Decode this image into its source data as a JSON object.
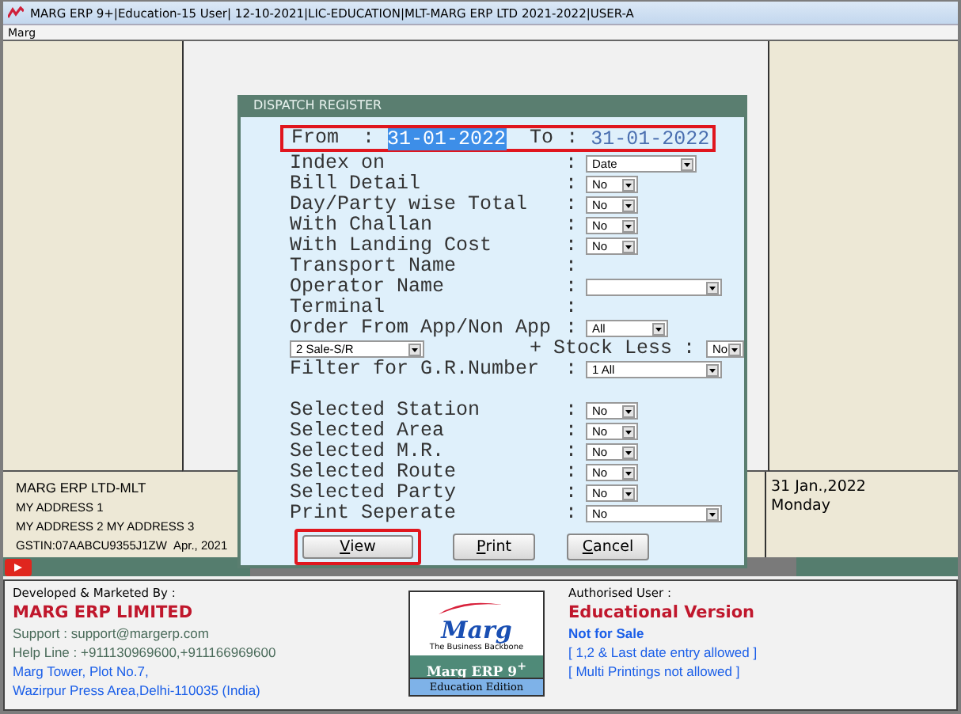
{
  "window": {
    "title": "MARG ERP 9+|Education-15 User| 12-10-2021|LIC-EDUCATION|MLT-MARG ERP LTD 2021-2022|USER-A"
  },
  "menu": [
    "Marg"
  ],
  "company": {
    "name": "MARG ERP LTD-MLT",
    "lines": [
      "MY ADDRESS 1",
      "MY ADDRESS 2 MY ADDRESS 3"
    ],
    "gstin": "GSTIN:07AABCU9355J1ZW",
    "period": "Apr., 2021"
  },
  "today": {
    "date": "31 Jan.,2022",
    "day": "Monday"
  },
  "dialog": {
    "title": "DISPATCH REGISTER",
    "date_range": {
      "from_label": "From",
      "from_colon": ":",
      "from": "31-01-2022",
      "from_selected": true,
      "to_label": "To",
      "to_colon": ":",
      "to": "31-01-2022",
      "to_selected": false
    },
    "fields": [
      {
        "kind": "sort",
        "label": "Index on",
        "colon": ":",
        "value": "Date"
      },
      {
        "kind": "toggle",
        "label": "Bill Detail",
        "colon": ":",
        "value": "No"
      },
      {
        "kind": "toggle",
        "label": "Day/Party wise Total",
        "colon": ":",
        "value": "No"
      },
      {
        "kind": "toggle",
        "label": "With Challan",
        "colon": ":",
        "value": "No"
      },
      {
        "kind": "toggle",
        "label": "With Landing Cost",
        "colon": ":",
        "value": "No"
      },
      {
        "kind": "text",
        "label": "Transport Name",
        "colon": ":"
      },
      {
        "kind": "combo",
        "label": "Operator Name",
        "colon": ":"
      },
      {
        "kind": "text",
        "label": "Terminal",
        "colon": ":"
      },
      {
        "kind": "choice",
        "label": "Order From App/Non App",
        "colon": ":",
        "value": "All"
      },
      {
        "kind": "split",
        "left_value": "2 Sale-S/R",
        "label": "+ Stock Less",
        "colon": ":",
        "value": "No"
      },
      {
        "kind": "combo",
        "label": "Filter for G.R.Number",
        "colon": ":",
        "value": "1 All"
      }
    ],
    "selection_fields": [
      {
        "kind": "toggle",
        "label": "Selected Station",
        "colon": ":",
        "value": "No"
      },
      {
        "kind": "toggle",
        "label": "Selected Area",
        "colon": ":",
        "value": "No"
      },
      {
        "kind": "toggle",
        "label": "Selected M.R.",
        "colon": ":",
        "value": "No"
      },
      {
        "kind": "toggle",
        "label": "Selected Route",
        "colon": ":",
        "value": "No"
      },
      {
        "kind": "toggle",
        "label": "Selected Party",
        "colon": ":",
        "value": "No"
      },
      {
        "kind": "combo",
        "label": "Print Seperate",
        "colon": ":",
        "value": "No"
      }
    ],
    "buttons": [
      {
        "label": "View",
        "selected": true
      },
      {
        "label": "Print",
        "selected": false
      },
      {
        "label": "Cancel",
        "selected": false
      }
    ]
  },
  "footer": {
    "left": [
      {
        "kind": "label",
        "text": "Developed & Marketed By :"
      },
      {
        "kind": "heading",
        "text": "MARG ERP LIMITED"
      },
      {
        "kind": "info",
        "text": "Support : support@margerp.com"
      },
      {
        "kind": "info",
        "text": "Help Line : +911130969600,+911166969600"
      },
      {
        "kind": "note",
        "text": "Marg Tower, Plot No.7,"
      },
      {
        "kind": "note",
        "text": "Wazirpur Press Area,Delhi-110035 (India)"
      }
    ],
    "logo": {
      "brand": "Marg",
      "tagline": "The Business Backbone",
      "product": "Marg ERP 9$^{+}$",
      "edition": "Education Edition"
    },
    "right": [
      {
        "kind": "label",
        "text": "Authorised User :"
      },
      {
        "kind": "heading",
        "text": "Educational Version"
      },
      {
        "kind": "strong",
        "text": "Not for Sale"
      },
      {
        "kind": "note",
        "text": "[ 1,2 & Last date entry allowed ]"
      },
      {
        "kind": "note",
        "text": "[ Multi Printings not allowed ]"
      }
    ]
  }
}
